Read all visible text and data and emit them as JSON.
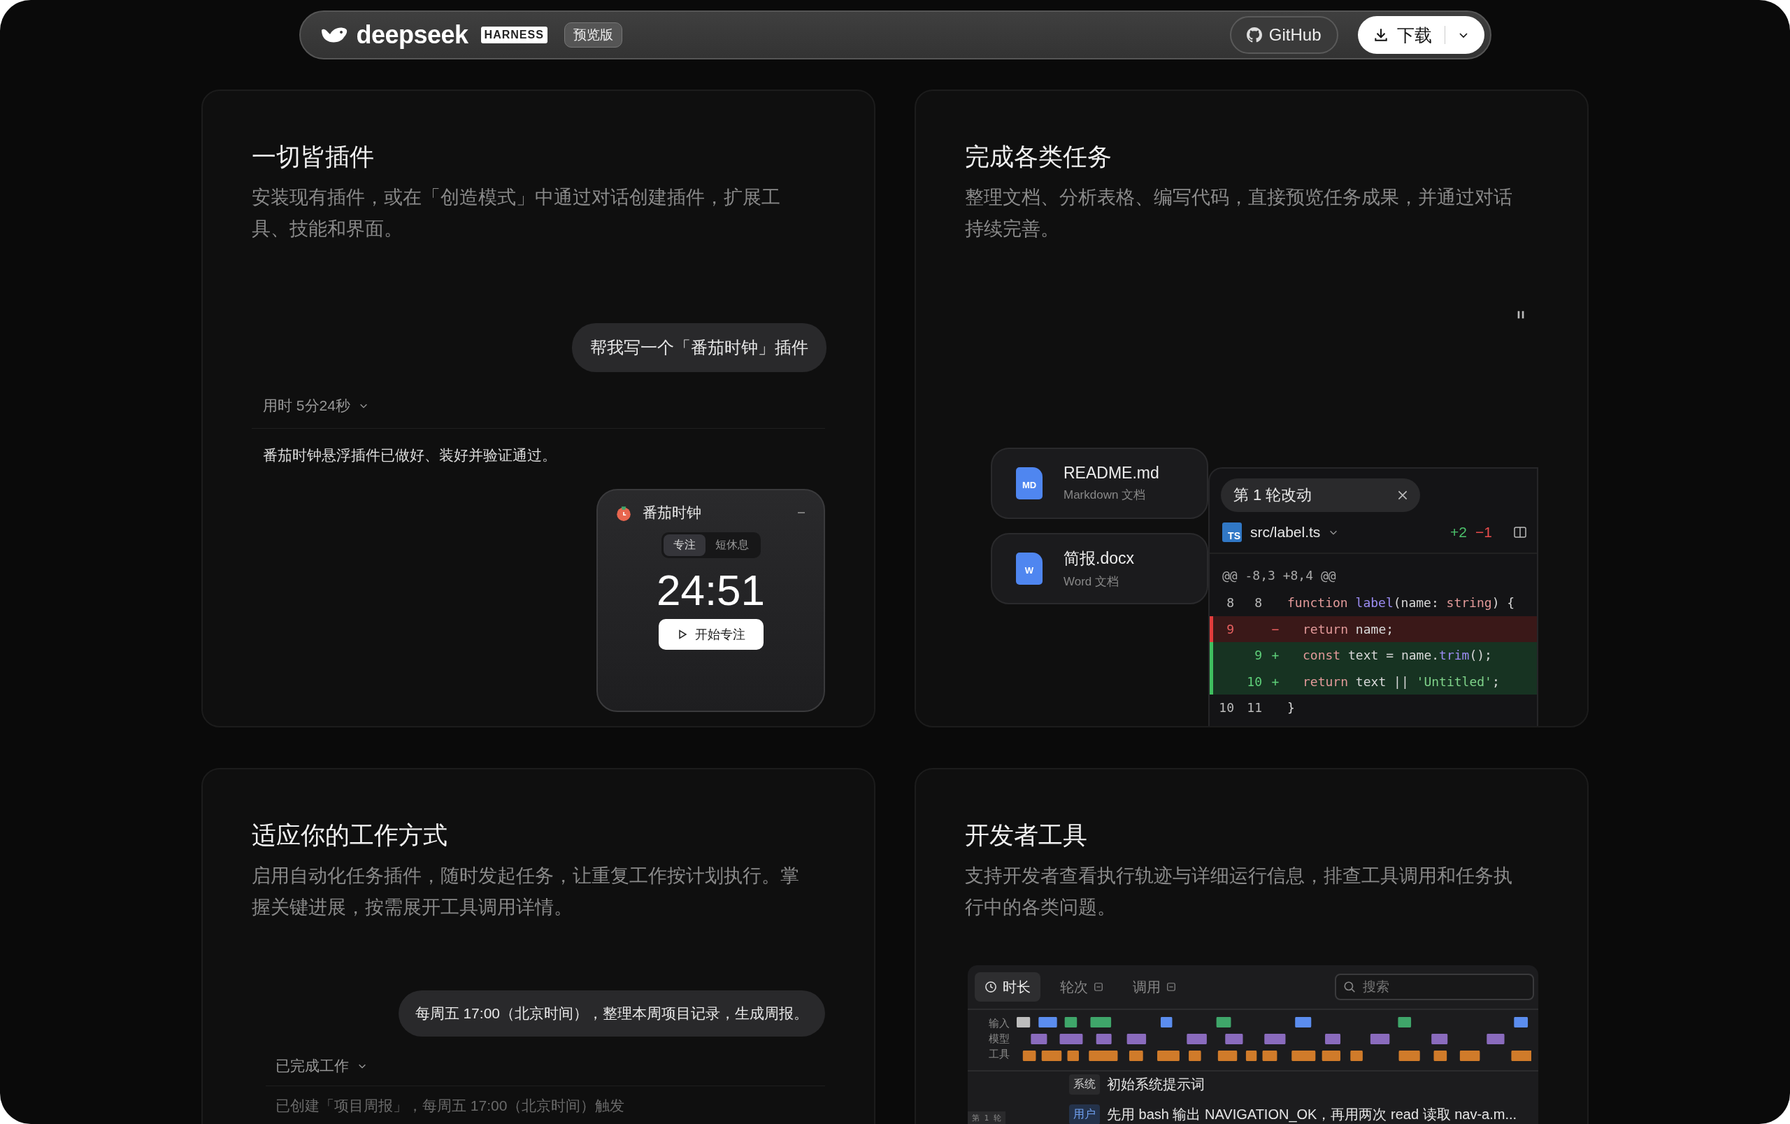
{
  "nav": {
    "brand": "deepseek",
    "badge": "HARNESS",
    "tag": "预览版",
    "github": "GitHub",
    "download": "下载"
  },
  "plugins_card": {
    "title": "一切皆插件",
    "description": "安装现有插件，或在「创造模式」中通过对话创建插件，扩展工具、技能和界面。",
    "prompt": "帮我写一个「番茄时钟」插件",
    "duration": "用时 5分24秒",
    "reply": "番茄时钟悬浮插件已做好、装好并验证通过。",
    "widget": {
      "title": "番茄时钟",
      "modes": [
        {
          "label": "专注",
          "selected": true
        },
        {
          "label": "短休息",
          "selected": false
        }
      ],
      "time": "24:51",
      "start": "开始专注"
    }
  },
  "tasks_card": {
    "title": "完成各类任务",
    "description": "整理文档、分析表格、编写代码，直接预览任务成果，并通过对话持续完善。",
    "files": [
      {
        "name": "README.md",
        "type": "Markdown 文档",
        "badge": "MD"
      },
      {
        "name": "简报.docx",
        "type": "Word 文档",
        "badge": "W"
      }
    ],
    "diff": {
      "title": "第 1 轮改动",
      "lang": "TS",
      "file": "src/label.ts",
      "added": "+2",
      "removed": "−1",
      "hunk": "@@ -8,3 +8,4 @@",
      "lines": [
        {
          "kind": "context",
          "old": "8",
          "new": "8",
          "indent": false,
          "code": [
            {
              "t": "function ",
              "color": "#e39a9a"
            },
            {
              "t": "label",
              "color": "#9b8cf2"
            },
            {
              "t": "(name: ",
              "color": "#d8d8d8"
            },
            {
              "t": "string",
              "color": "#e39a9a"
            },
            {
              "t": ") {",
              "color": "#d8d8d8"
            }
          ]
        },
        {
          "kind": "del",
          "old": "9",
          "sign": "−",
          "indent": true,
          "code": [
            {
              "t": "return",
              "color": "#e39a9a"
            },
            {
              "t": " name;",
              "color": "#d8d8d8"
            }
          ]
        },
        {
          "kind": "add",
          "new": "9",
          "sign": "+",
          "indent": true,
          "code": [
            {
              "t": "const",
              "color": "#e39a9a"
            },
            {
              "t": " text = name.",
              "color": "#d8d8d8"
            },
            {
              "t": "trim",
              "color": "#9b8cf2"
            },
            {
              "t": "();",
              "color": "#d8d8d8"
            }
          ]
        },
        {
          "kind": "add",
          "new": "10",
          "sign": "+",
          "indent": true,
          "code": [
            {
              "t": "return",
              "color": "#e39a9a"
            },
            {
              "t": " text || ",
              "color": "#d8d8d8"
            },
            {
              "t": "'Untitled'",
              "color": "#7fd38a"
            },
            {
              "t": ";",
              "color": "#d8d8d8"
            }
          ]
        },
        {
          "kind": "context",
          "old": "10",
          "new": "11",
          "indent": false,
          "code": [
            {
              "t": "}",
              "color": "#d8d8d8"
            }
          ]
        }
      ]
    }
  },
  "workflow_card": {
    "title": "适应你的工作方式",
    "description": "启用自动化任务插件，随时发起任务，让重复工作按计划执行。掌握关键进展，按需展开工具调用详情。",
    "prompt": "每周五 17:00（北京时间），整理本周项目记录，生成周报。",
    "status": "已完成工作",
    "result": "已创建「项目周报」，每周五 17:00（北京时间）触发"
  },
  "devtools_card": {
    "title": "开发者工具",
    "description": "支持开发者查看执行轨迹与详细运行信息，排查工具调用和任务执行中的各类问题。",
    "tabs": [
      {
        "label": "时长",
        "kind": "clock",
        "selected": true
      },
      {
        "label": "轮次",
        "kind": "filter",
        "selected": false
      },
      {
        "label": "调用",
        "kind": "filter",
        "selected": false
      }
    ],
    "search_placeholder": "搜索",
    "lanes": [
      "输入",
      "模型",
      "工具"
    ],
    "round": "第 1 轮",
    "messages": [
      {
        "role": "系统",
        "kind": "system",
        "text": "初始系统提示词"
      },
      {
        "role": "用户",
        "kind": "user",
        "text": "先用 bash 输出 NAVIGATION_OK，再用两次 read 读取 nav-a.m..."
      }
    ]
  }
}
